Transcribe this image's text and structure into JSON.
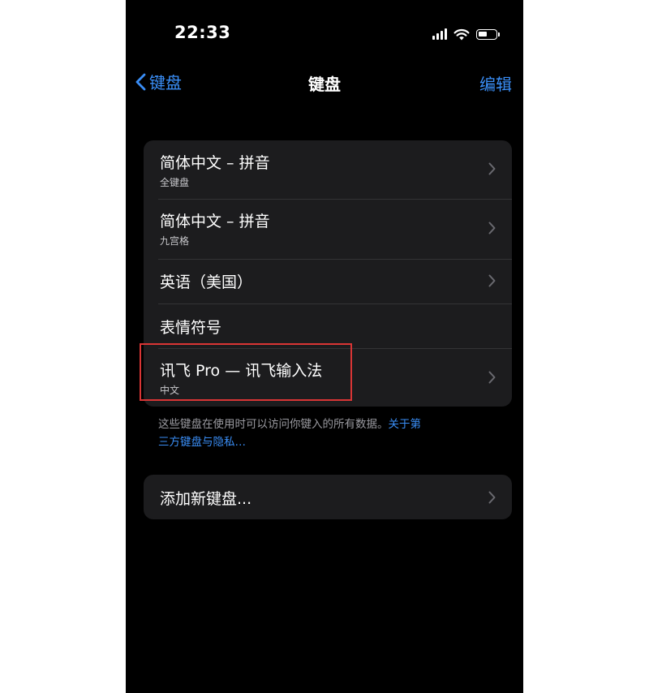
{
  "status_bar": {
    "time": "22:33"
  },
  "nav": {
    "back_label": "键盘",
    "title": "键盘",
    "edit_label": "编辑"
  },
  "keyboards": [
    {
      "title": "简体中文 – 拼音",
      "subtitle": "全键盘"
    },
    {
      "title": "简体中文 – 拼音",
      "subtitle": "九宫格"
    },
    {
      "title": "英语（美国）",
      "subtitle": ""
    },
    {
      "title": "表情符号",
      "subtitle": ""
    },
    {
      "title": "讯飞 Pro — 讯飞输入法",
      "subtitle": "中文"
    }
  ],
  "footer": {
    "note": "这些键盘在使用时可以访问你键入的所有数据。",
    "link_part1": "关于第",
    "link_part2": "三方键盘与隐私…"
  },
  "add_keyboard": {
    "label": "添加新键盘..."
  },
  "colors": {
    "accent": "#3a8ef6",
    "highlight": "#d93535",
    "cell_bg": "#1c1c1e"
  }
}
